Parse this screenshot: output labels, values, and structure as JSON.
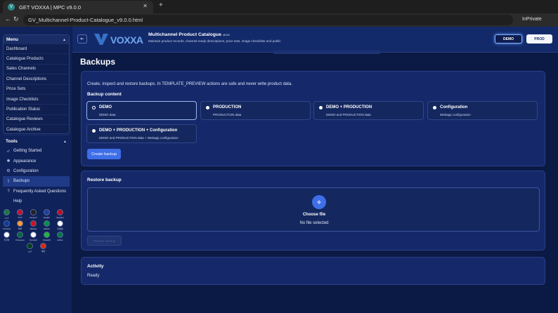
{
  "browser": {
    "tab_title": "GET VOXXA | MPC v9.0.0",
    "favicon_letter": "V",
    "url": "GV_Multichannel-Product-Catalogue_v9.0.0.html",
    "private_label": "InPrivate",
    "icons": {
      "close": "close-icon",
      "new_tab": "plus-icon",
      "back": "arrow-left-icon",
      "reload": "reload-icon"
    }
  },
  "header": {
    "logo_text": "VOXXA",
    "app_title": "Multichannel Product Catalogue",
    "app_version": "v9.0.0",
    "app_subtitle": "Maintain product records, channel-ready descriptions, price sets, image checklists and public",
    "demo_label": "DEMO",
    "prod_label": "PROD",
    "accent_color": "#7fb0ff"
  },
  "sidebar": {
    "menu_title": "Menu",
    "menu_items": [
      {
        "label": "Dashboard"
      },
      {
        "label": "Catalogue Products"
      },
      {
        "label": "Sales Channels"
      },
      {
        "label": "Channel Descriptions"
      },
      {
        "label": "Price Sets"
      },
      {
        "label": "Image Checklists"
      },
      {
        "label": "Publication Status"
      },
      {
        "label": "Catalogue Reviews"
      },
      {
        "label": "Catalogue Archive"
      }
    ],
    "tools_title": "Tools",
    "tools_items": [
      {
        "label": "Getting Started",
        "icon": "rocket-icon"
      },
      {
        "label": "Appearance",
        "icon": "palette-icon"
      },
      {
        "label": "Configuration",
        "icon": "gear-icon"
      },
      {
        "label": "Backups",
        "icon": "upload-icon",
        "active": true
      },
      {
        "label": "Frequently Asked Questions",
        "icon": "question-icon"
      },
      {
        "label": "Help",
        "icon": "help-icon"
      }
    ],
    "languages": [
      "عربي",
      "বাংলা",
      "Deutsch",
      "English",
      "Español",
      "Français",
      "हिन्दी",
      "Bahasa",
      "Italiano",
      "日本語",
      "한국어",
      "Portugues",
      "Русский",
      "Kiswahili",
      "isiZulu",
      "اردو",
      "中文"
    ]
  },
  "main": {
    "page_title": "Backups",
    "backup": {
      "intro": "Create, inspect and restore backups. In TEMPLATE_PREVIEW actions are safe and never write product data.",
      "content_title": "Backup content",
      "options": [
        {
          "label": "DEMO",
          "desc": "DEMO data",
          "selected": true
        },
        {
          "label": "PRODUCTION",
          "desc": "PRODUCTION data",
          "selected": false
        },
        {
          "label": "DEMO + PRODUCTION",
          "desc": "DEMO and PRODUCTION data",
          "selected": false
        },
        {
          "label": "Configuration",
          "desc": "Webapp configuration",
          "selected": false
        },
        {
          "label": "DEMO + PRODUCTION + Configuration",
          "desc": "DEMO and PRODUCTION data + Webapp configuration",
          "selected": false
        }
      ],
      "create_label": "Create backup"
    },
    "restore": {
      "title": "Restore backup",
      "choose_label": "Choose file",
      "no_file": "No file selected",
      "restore_label": "Restore backup"
    },
    "activity": {
      "title": "Activity",
      "status": "Ready"
    }
  }
}
